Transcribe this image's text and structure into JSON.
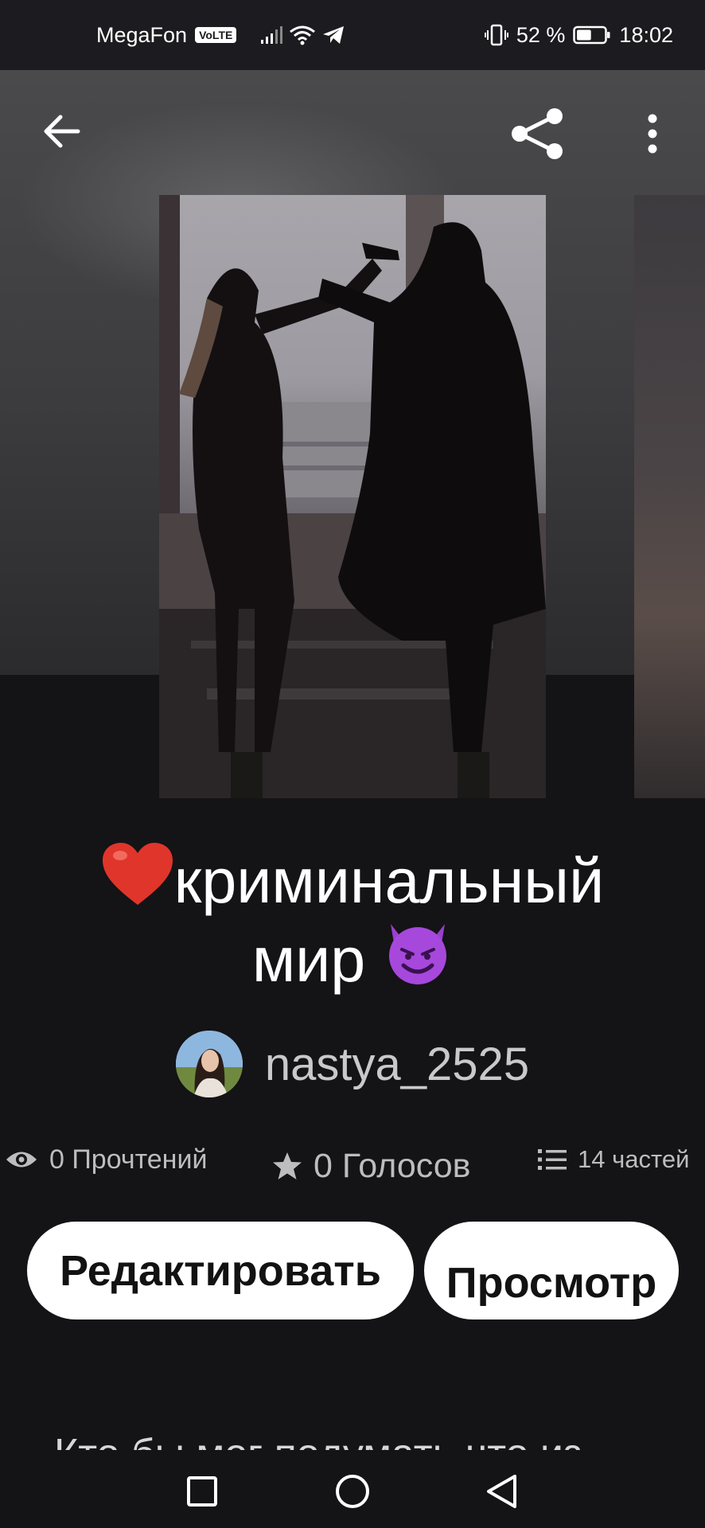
{
  "status_bar": {
    "carrier": "MegaFon",
    "volte": "VoLTE",
    "battery_percent": "52 %",
    "time": "18:02",
    "battery_level": 0.52
  },
  "top_bar": {
    "back_icon": "arrow-left-icon",
    "share_icon": "share-icon",
    "menu_icon": "more-vert-icon"
  },
  "story": {
    "title_line1": "криминальный",
    "title_line2": "мир",
    "title_prefix_emoji": "red-heart",
    "title_suffix_emoji": "smiling-devil",
    "author": "nastya_2525",
    "stats": {
      "reads": "0 Прочтений",
      "votes": "0 Голосов",
      "parts": "14 частей"
    },
    "description_preview": "Кто бы мог подумать что из"
  },
  "buttons": {
    "edit": "Редактировать",
    "preview": "Просмотр"
  },
  "colors": {
    "background": "#141316",
    "button_bg": "#ffffff",
    "button_text": "#121212",
    "stat_text": "#bdbcc0"
  }
}
